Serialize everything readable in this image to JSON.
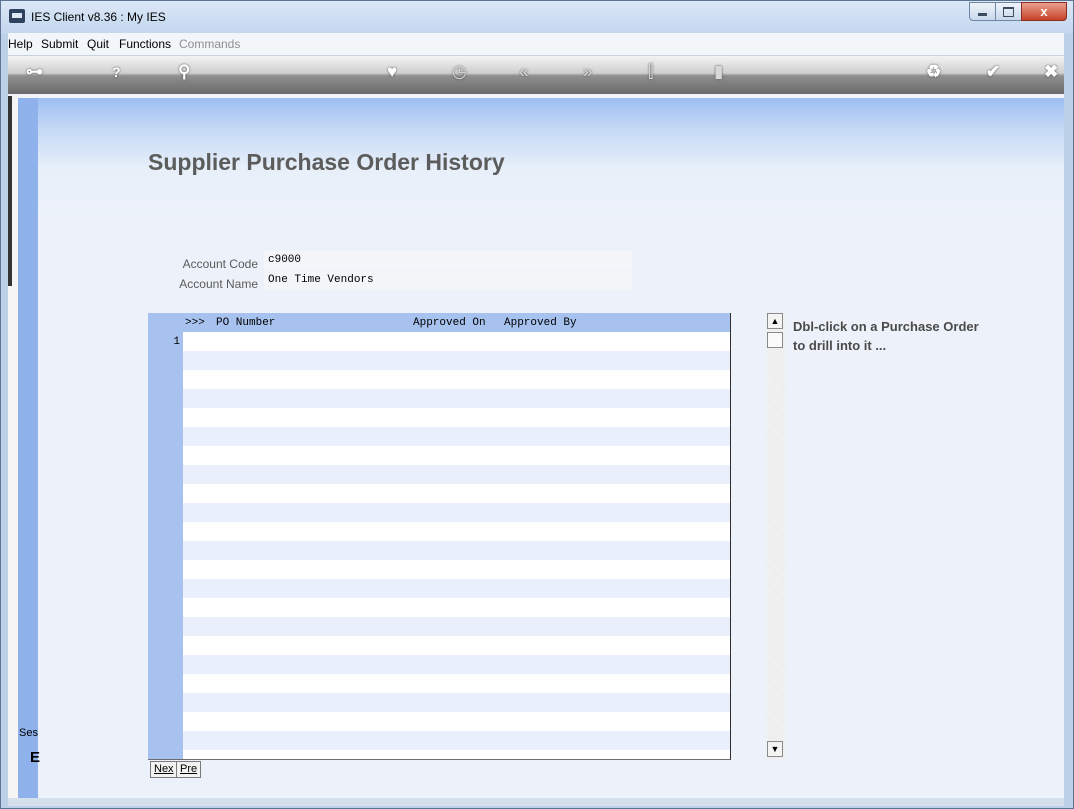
{
  "window": {
    "title": "IES Client v8.36 : My IES",
    "controls": {
      "minimize": "",
      "maximize": "",
      "close": "x"
    }
  },
  "menu": {
    "items": [
      {
        "label": "Help",
        "enabled": true
      },
      {
        "label": "Submit",
        "enabled": true
      },
      {
        "label": "Quit",
        "enabled": true
      },
      {
        "label": "Functions",
        "enabled": true
      },
      {
        "label": "Commands",
        "enabled": false
      }
    ]
  },
  "toolbar": {
    "icons": [
      {
        "name": "key-icon",
        "glyph": "⊶"
      },
      {
        "name": "help-icon",
        "glyph": "?"
      },
      {
        "name": "search-icon",
        "glyph": "⚲"
      },
      {
        "name": "heart-icon",
        "glyph": "♥"
      },
      {
        "name": "clock-icon",
        "glyph": "◷"
      },
      {
        "name": "previous-icon",
        "glyph": "«"
      },
      {
        "name": "next-icon",
        "glyph": "»"
      },
      {
        "name": "tools-icon",
        "glyph": "⫿"
      },
      {
        "name": "page-icon",
        "glyph": "▮"
      },
      {
        "name": "recycle-icon",
        "glyph": "♻"
      },
      {
        "name": "check-icon",
        "glyph": "✔"
      },
      {
        "name": "close-icon",
        "glyph": "✖"
      }
    ]
  },
  "sidebar": {
    "session_label": "Ses",
    "session_icon": "E"
  },
  "page": {
    "title": "Supplier Purchase Order History",
    "account_code_label": "Account Code",
    "account_code_value": "c9000",
    "account_name_label": "Account Name",
    "account_name_value": "One Time Vendors"
  },
  "grid": {
    "row_marker": ">>>",
    "columns": [
      "PO Number",
      "Approved On",
      "Approved By"
    ],
    "first_row_number": "1",
    "buttons": {
      "next": "Nex",
      "prev": "Pre"
    }
  },
  "hint": {
    "line1": "Dbl-click on a Purchase Order",
    "line2": "to drill into it ..."
  },
  "scrollbar": {
    "up": "▲",
    "down": "▼"
  }
}
